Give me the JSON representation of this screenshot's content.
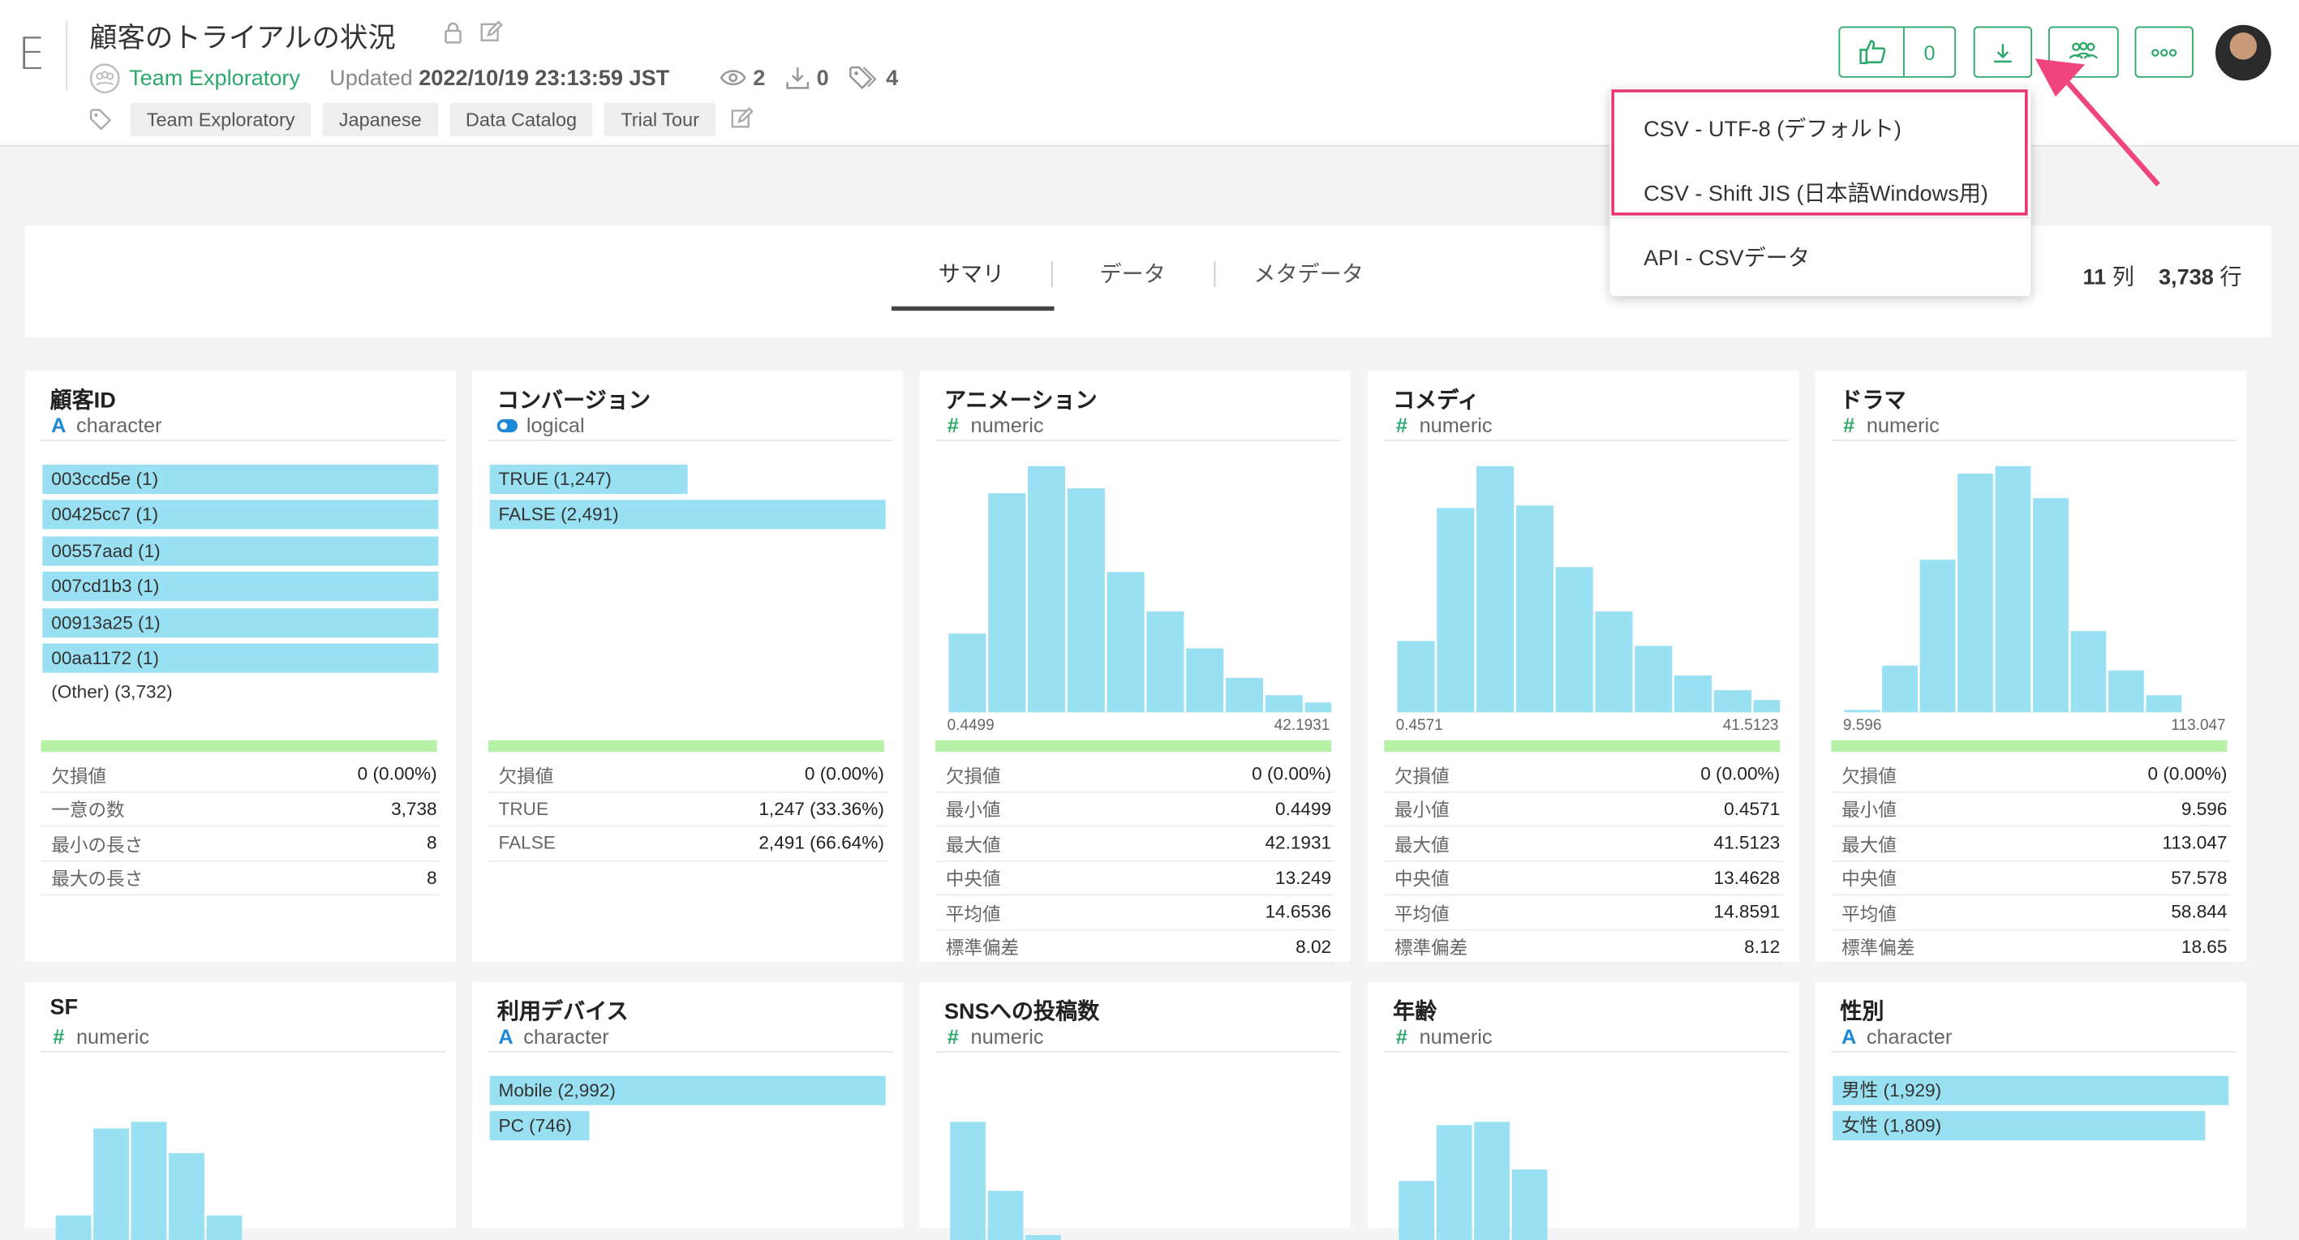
{
  "app": {
    "letter": "E",
    "title": "顧客のトライアルの状況"
  },
  "meta": {
    "team": "Team Exploratory",
    "updated_label": "Updated",
    "updated_value": "2022/10/19 23:13:59 JST",
    "views": "2",
    "downloads": "0",
    "tag_count": "4"
  },
  "tags": [
    "Team Exploratory",
    "Japanese",
    "Data Catalog",
    "Trial Tour"
  ],
  "toolbar": {
    "like_count": "0"
  },
  "download_menu": {
    "items": [
      "CSV - UTF-8 (デフォルト)",
      "CSV - Shift JIS (日本語Windows用)",
      "API - CSVデータ"
    ]
  },
  "tabs": [
    "サマリ",
    "データ",
    "メタデータ"
  ],
  "active_tab": "サマリ",
  "counts": {
    "cols": "11",
    "cols_unit": "列",
    "rows": "3,738",
    "rows_unit": "行"
  },
  "colors": {
    "accent": "#2ca86b",
    "bar": "#99e1f2",
    "highlight": "#e8366f",
    "missing": "#b7f0a7"
  },
  "columns": [
    {
      "name": "顧客ID",
      "type": "character",
      "type_icon": "A",
      "top_values": [
        {
          "label": "003ccd5e (1)",
          "frac": 1.0
        },
        {
          "label": "00425cc7 (1)",
          "frac": 1.0
        },
        {
          "label": "00557aad (1)",
          "frac": 1.0
        },
        {
          "label": "007cd1b3 (1)",
          "frac": 1.0
        },
        {
          "label": "00913a25 (1)",
          "frac": 1.0
        },
        {
          "label": "00aa1172 (1)",
          "frac": 1.0
        }
      ],
      "other": "(Other) (3,732)",
      "stats": [
        {
          "k": "欠損値",
          "v": "0 (0.00%)"
        },
        {
          "k": "一意の数",
          "v": "3,738"
        },
        {
          "k": "最小の長さ",
          "v": "8"
        },
        {
          "k": "最大の長さ",
          "v": "8"
        }
      ]
    },
    {
      "name": "コンバージョン",
      "type": "logical",
      "type_icon": "toggle",
      "top_values": [
        {
          "label": "TRUE (1,247)",
          "frac": 0.5
        },
        {
          "label": "FALSE (2,491)",
          "frac": 1.0
        }
      ],
      "stats": [
        {
          "k": "欠損値",
          "v": "0 (0.00%)"
        },
        {
          "k": "TRUE",
          "v": "1,247 (33.36%)"
        },
        {
          "k": "FALSE",
          "v": "2,491 (66.64%)"
        }
      ]
    },
    {
      "name": "アニメーション",
      "type": "numeric",
      "type_icon": "#",
      "hist": [
        0.32,
        0.89,
        1.0,
        0.91,
        0.57,
        0.41,
        0.26,
        0.14,
        0.07,
        0.04
      ],
      "min": "0.4499",
      "max": "42.1931",
      "stats": [
        {
          "k": "欠損値",
          "v": "0 (0.00%)"
        },
        {
          "k": "最小値",
          "v": "0.4499"
        },
        {
          "k": "最大値",
          "v": "42.1931"
        },
        {
          "k": "中央値",
          "v": "13.249"
        },
        {
          "k": "平均値",
          "v": "14.6536"
        },
        {
          "k": "標準偏差",
          "v": "8.02"
        }
      ]
    },
    {
      "name": "コメディ",
      "type": "numeric",
      "type_icon": "#",
      "hist": [
        0.29,
        0.83,
        1.0,
        0.84,
        0.59,
        0.41,
        0.27,
        0.15,
        0.09,
        0.05
      ],
      "min": "0.4571",
      "max": "41.5123",
      "stats": [
        {
          "k": "欠損値",
          "v": "0 (0.00%)"
        },
        {
          "k": "最小値",
          "v": "0.4571"
        },
        {
          "k": "最大値",
          "v": "41.5123"
        },
        {
          "k": "中央値",
          "v": "13.4628"
        },
        {
          "k": "平均値",
          "v": "14.8591"
        },
        {
          "k": "標準偏差",
          "v": "8.12"
        }
      ]
    },
    {
      "name": "ドラマ",
      "type": "numeric",
      "type_icon": "#",
      "hist": [
        0.01,
        0.19,
        0.62,
        0.97,
        1.0,
        0.87,
        0.33,
        0.17,
        0.07
      ],
      "min": "9.596",
      "max": "113.047",
      "stats": [
        {
          "k": "欠損値",
          "v": "0 (0.00%)"
        },
        {
          "k": "最小値",
          "v": "9.596"
        },
        {
          "k": "最大値",
          "v": "113.047"
        },
        {
          "k": "中央値",
          "v": "57.578"
        },
        {
          "k": "平均値",
          "v": "58.844"
        },
        {
          "k": "標準偏差",
          "v": "18.65"
        }
      ]
    },
    {
      "name": "SF",
      "type": "numeric",
      "type_icon": "#",
      "hist": [
        0.15,
        0.68,
        0.72,
        0.53,
        0.15
      ]
    },
    {
      "name": "利用デバイス",
      "type": "character",
      "type_icon": "A",
      "top_values": [
        {
          "label": "Mobile (2,992)",
          "frac": 1.0
        },
        {
          "label": "PC (746)",
          "frac": 0.25
        }
      ]
    },
    {
      "name": "SNSへの投稿数",
      "type": "numeric",
      "type_icon": "#",
      "hist": [
        0.72,
        0.3,
        0.03
      ]
    },
    {
      "name": "年齢",
      "type": "numeric",
      "type_icon": "#",
      "hist": [
        0.36,
        0.7,
        0.72,
        0.43
      ]
    },
    {
      "name": "性別",
      "type": "character",
      "type_icon": "A",
      "top_values": [
        {
          "label": "男性 (1,929)",
          "frac": 1.0
        },
        {
          "label": "女性 (1,809)",
          "frac": 0.94
        }
      ]
    }
  ]
}
